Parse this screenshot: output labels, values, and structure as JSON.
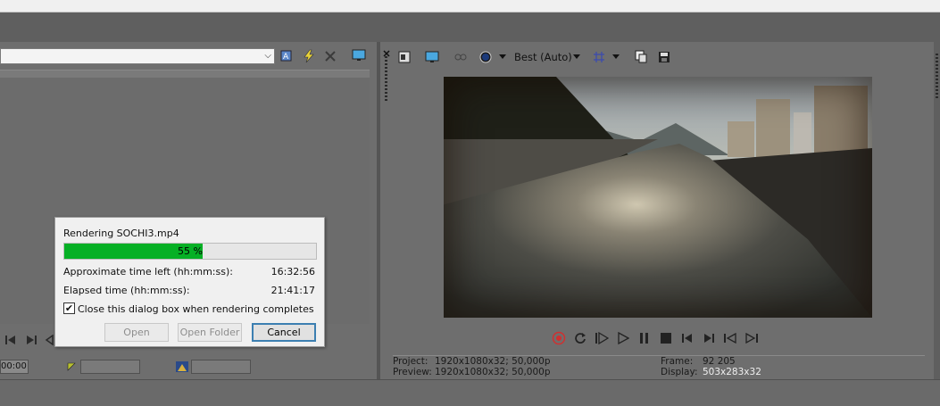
{
  "left_panel": {
    "combo_value": "",
    "timecode": "00:00"
  },
  "preview_toolbar": {
    "quality": "Best (Auto)"
  },
  "render_dialog": {
    "title": "Rendering SOCHI3.mp4",
    "progress_percent": 55,
    "progress_label": "55 %",
    "time_left_label": "Approximate time left (hh:mm:ss):",
    "time_left_value": "16:32:56",
    "elapsed_label": "Elapsed time (hh:mm:ss):",
    "elapsed_value": "21:41:17",
    "close_checkbox_label": "Close this dialog box when rendering completes",
    "close_checkbox_checked": true,
    "open_button": "Open",
    "open_folder_button": "Open Folder",
    "cancel_button": "Cancel"
  },
  "preview_info": {
    "project_label": "Project:",
    "project_value": "1920x1080x32; 50,000p",
    "preview_label": "Preview:",
    "preview_value": "1920x1080x32; 50,000p",
    "frame_label": "Frame:",
    "frame_value": "92 205",
    "display_label": "Display:",
    "display_value": "503x283x32"
  },
  "icons": [
    "toggle-icon",
    "lightning-icon",
    "close-icon",
    "monitor-icon",
    "split-icon",
    "overlay-icon",
    "circle-icon",
    "grid-icon",
    "copy-icon",
    "save-icon",
    "record-icon",
    "loop-icon",
    "play-from-start-icon",
    "play-icon",
    "pause-icon",
    "stop-icon",
    "prev-icon",
    "next-icon",
    "prev-frame-icon",
    "next-frame-icon"
  ],
  "colors": {
    "progress": "#06b025",
    "record": "#d03030"
  }
}
